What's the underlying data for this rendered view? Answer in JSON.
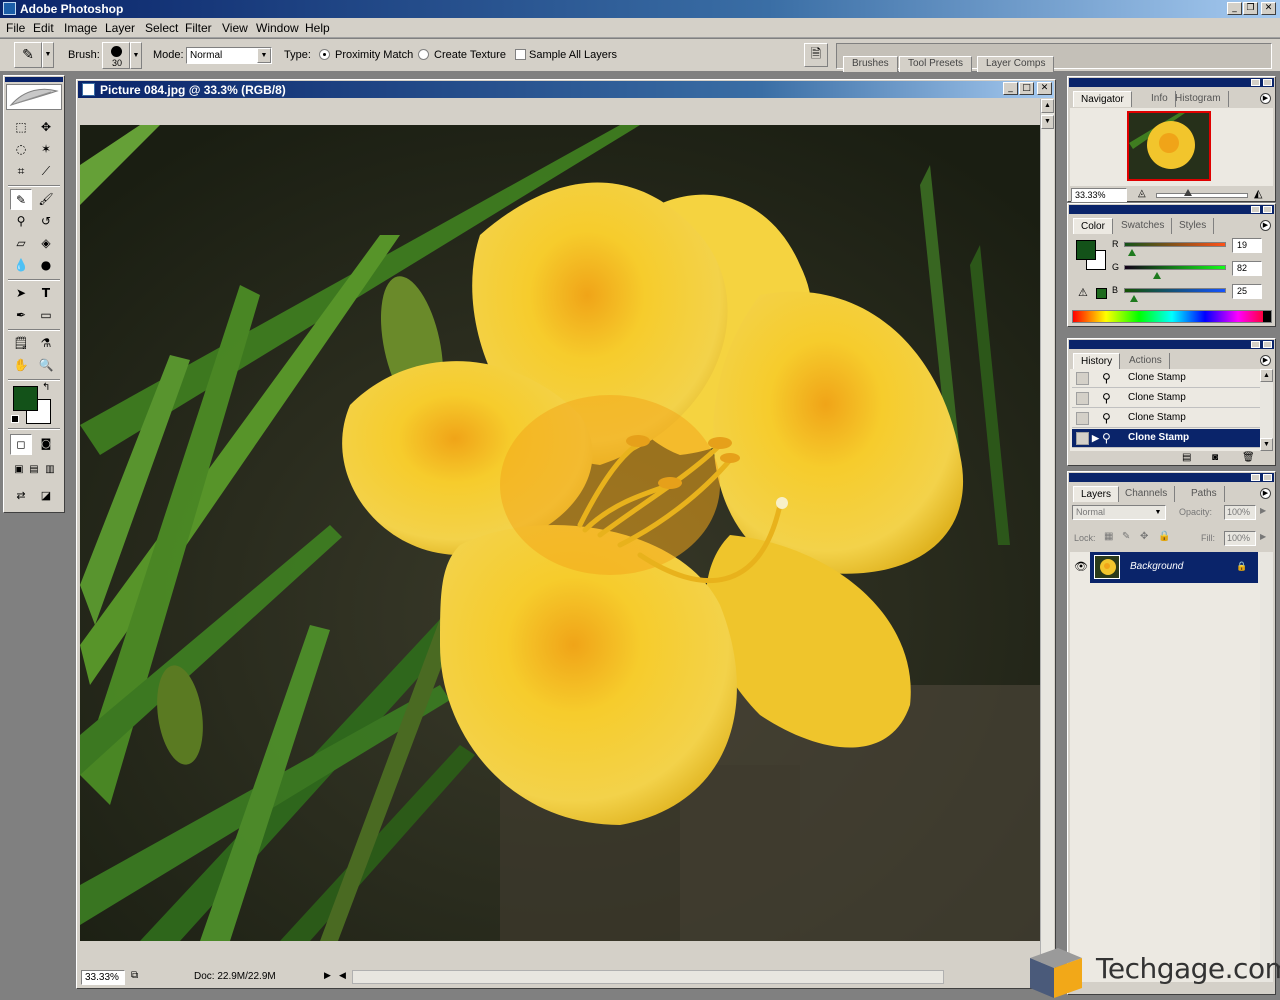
{
  "app": {
    "title": "Adobe Photoshop"
  },
  "menu": [
    "File",
    "Edit",
    "Image",
    "Layer",
    "Select",
    "Filter",
    "View",
    "Window",
    "Help"
  ],
  "options": {
    "brush_label": "Brush:",
    "brush_size": "30",
    "mode_label": "Mode:",
    "mode_value": "Normal",
    "type_label": "Type:",
    "proximity": "Proximity Match",
    "create_texture": "Create Texture",
    "sample_all": "Sample All Layers",
    "selected_type": "Proximity Match",
    "sample_all_checked": false
  },
  "palette_well": [
    "Brushes",
    "Tool Presets",
    "Layer Comps"
  ],
  "document": {
    "title": "Picture 084.jpg @ 33.3% (RGB/8)",
    "zoom": "33.33%",
    "doc_size": "Doc: 22.9M/22.9M"
  },
  "navigator": {
    "tabs": [
      "Navigator",
      "Info",
      "Histogram"
    ],
    "zoom": "33.33%"
  },
  "color": {
    "tabs": [
      "Color",
      "Swatches",
      "Styles"
    ],
    "channels": [
      {
        "label": "R",
        "value": "19"
      },
      {
        "label": "G",
        "value": "82"
      },
      {
        "label": "B",
        "value": "25"
      }
    ],
    "foreground": "#135219",
    "background": "#ffffff"
  },
  "history": {
    "tabs": [
      "History",
      "Actions"
    ],
    "items": [
      "Clone Stamp",
      "Clone Stamp",
      "Clone Stamp",
      "Clone Stamp"
    ]
  },
  "layers": {
    "tabs": [
      "Layers",
      "Channels",
      "Paths"
    ],
    "blend_mode": "Normal",
    "opacity_label": "Opacity:",
    "opacity": "100%",
    "lock_label": "Lock:",
    "fill_label": "Fill:",
    "fill": "100%",
    "layer_name": "Background"
  },
  "watermark": "Techgage.com",
  "colors": {
    "title_bar": "#0a246a",
    "chrome": "#d4d0c8",
    "selection": "#0a246a"
  }
}
